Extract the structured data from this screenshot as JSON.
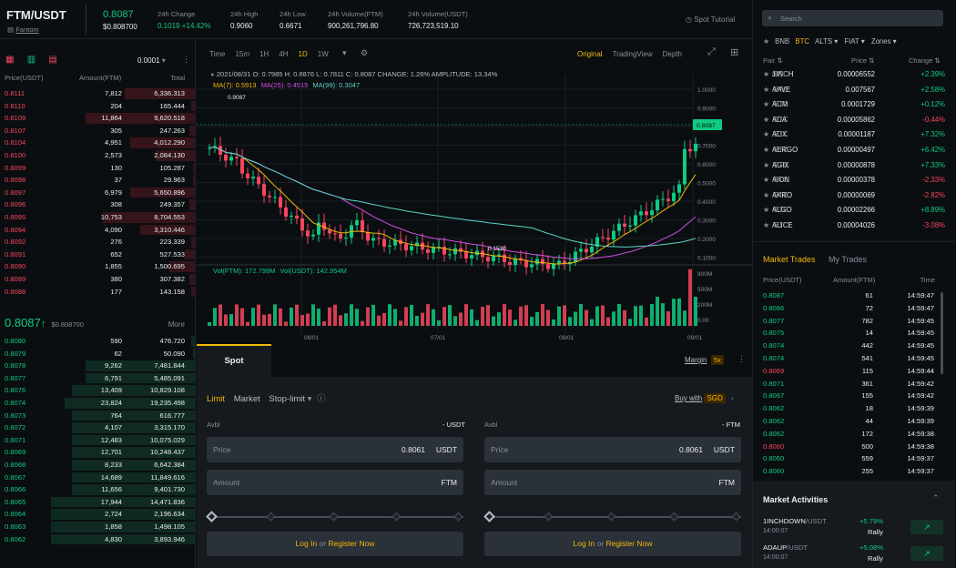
{
  "header": {
    "pair": "FTM/USDT",
    "project": "Fantom",
    "price": "0.8087",
    "price_usd": "$0.808700",
    "stats": [
      {
        "label": "24h Change",
        "value": "0.1019 +14.42%",
        "color": "green"
      },
      {
        "label": "24h High",
        "value": "0.9060"
      },
      {
        "label": "24h Low",
        "value": "0.6671"
      },
      {
        "label": "24h Volume(FTM)",
        "value": "900,261,796.80"
      },
      {
        "label": "24h Volume(USDT)",
        "value": "726,723,519.10"
      }
    ],
    "spot_tutorial": "Spot Tutorial"
  },
  "orderbook": {
    "precision": "0.0001",
    "columns": [
      "Price(USDT)",
      "Amount(FTM)",
      "Total"
    ],
    "asks": [
      [
        "0.8111",
        "7,812",
        "6,336.313"
      ],
      [
        "0.8110",
        "204",
        "165.444"
      ],
      [
        "0.8109",
        "11,864",
        "9,620.518"
      ],
      [
        "0.8107",
        "305",
        "247.263"
      ],
      [
        "0.8104",
        "4,951",
        "4,012.290"
      ],
      [
        "0.8100",
        "2,573",
        "2,084.130"
      ],
      [
        "0.8099",
        "130",
        "105.287"
      ],
      [
        "0.8098",
        "37",
        "29.963"
      ],
      [
        "0.8097",
        "6,979",
        "5,650.896"
      ],
      [
        "0.8096",
        "308",
        "249.357"
      ],
      [
        "0.8095",
        "10,753",
        "8,704.553"
      ],
      [
        "0.8094",
        "4,090",
        "3,310.446"
      ],
      [
        "0.8092",
        "276",
        "223.339"
      ],
      [
        "0.8091",
        "652",
        "527.533"
      ],
      [
        "0.8090",
        "1,855",
        "1,500.695"
      ],
      [
        "0.8089",
        "380",
        "307.382"
      ],
      [
        "0.8088",
        "177",
        "143.158"
      ]
    ],
    "ask_depth": [
      0.36,
      0.02,
      0.56,
      0.03,
      0.33,
      0.2,
      0.01,
      0.01,
      0.33,
      0.03,
      0.47,
      0.28,
      0.02,
      0.05,
      0.13,
      0.03,
      0.02
    ],
    "mid_price": "0.8087",
    "mid_arrow": "↑",
    "mid_usd": "$0.808700",
    "more": "More",
    "bids": [
      [
        "0.8080",
        "590",
        "476.720"
      ],
      [
        "0.8079",
        "62",
        "50.090"
      ],
      [
        "0.8078",
        "9,262",
        "7,481.844"
      ],
      [
        "0.8077",
        "6,791",
        "5,485.091"
      ],
      [
        "0.8076",
        "13,409",
        "10,829.108"
      ],
      [
        "0.8074",
        "23,824",
        "19,235.498"
      ],
      [
        "0.8073",
        "764",
        "616.777"
      ],
      [
        "0.8072",
        "4,107",
        "3,315.170"
      ],
      [
        "0.8071",
        "12,483",
        "10,075.029"
      ],
      [
        "0.8069",
        "12,701",
        "10,248.437"
      ],
      [
        "0.8068",
        "8,233",
        "6,642.384"
      ],
      [
        "0.8067",
        "14,689",
        "11,849.616"
      ],
      [
        "0.8066",
        "11,656",
        "9,401.730"
      ],
      [
        "0.8065",
        "17,944",
        "14,471.836"
      ],
      [
        "0.8064",
        "2,724",
        "2,196.634"
      ],
      [
        "0.8063",
        "1,858",
        "1,498.105"
      ],
      [
        "0.8062",
        "4,830",
        "3,893.946"
      ]
    ],
    "bid_depth": [
      0.02,
      0.01,
      0.56,
      0.56,
      0.63,
      0.67,
      0.63,
      0.63,
      0.63,
      0.63,
      0.63,
      0.63,
      0.63,
      0.74,
      0.74,
      0.74,
      0.74
    ]
  },
  "chart": {
    "intervals": [
      "Time",
      "15m",
      "1H",
      "4H",
      "1D",
      "1W"
    ],
    "active_interval": "1D",
    "views": [
      "Original",
      "TradingView",
      "Depth"
    ],
    "active_view": "Original",
    "ohlc": "2021/08/31  O: 0.7985  H: 0.8876  L: 0.7811  C: 0.8087  CHANGE: 1.26%  AMPLITUDE: 13.34%",
    "ma7": "MA(7): 0.5913",
    "ma25": "MA(25): 0.4515",
    "ma99": "MA(99): 0.3047",
    "vol_ftm": "Vol(FTM): 172.798M",
    "vol_usdt": "Vol(USDT): 142.954M",
    "high_label": "0.9087",
    "low_label": "0.1530",
    "last_price_tag": "0.8087",
    "price_axis": [
      "1.0000",
      "0.9000",
      "0.8000",
      "0.7000",
      "0.6000",
      "0.5000",
      "0.4000",
      "0.3000",
      "0.2000",
      "0.1000"
    ],
    "vol_axis": [
      "800M",
      "500M",
      "200M",
      "0.00"
    ],
    "date_axis": [
      "08/01",
      "07/01",
      "08/01",
      "09/01"
    ]
  },
  "trade": {
    "tab": "Spot",
    "margin": "Margin",
    "leverage": "5x",
    "order_types": [
      "Limit",
      "Market",
      "Stop-limit"
    ],
    "buy_with": "Buy with",
    "buy_currency": "SGD",
    "avbl": "Avbl",
    "buy": {
      "avbl_unit": "- USDT",
      "price_label": "Price",
      "price_value": "0.8061",
      "price_unit": "USDT",
      "amount_label": "Amount",
      "amount_unit": "FTM"
    },
    "sell": {
      "avbl_unit": "- FTM",
      "price_label": "Price",
      "price_value": "0.8061",
      "price_unit": "USDT",
      "amount_label": "Amount",
      "amount_unit": "FTM"
    },
    "login": "Log In",
    "or": "or",
    "register": "Register Now"
  },
  "market": {
    "search_placeholder": "Search",
    "filters": [
      "BNB",
      "BTC",
      "ALTS",
      "FIAT",
      "Zones"
    ],
    "active_filter": "BTC",
    "columns": [
      "Pair",
      "Price",
      "Change"
    ],
    "pairs": [
      [
        "1INCH",
        "/BTC",
        "0.00006552",
        "+2.39%"
      ],
      [
        "AAVE",
        "/BTC",
        "0.007567",
        "+2.58%"
      ],
      [
        "ACM",
        "/BTC",
        "0.0001729",
        "+0.12%"
      ],
      [
        "ADA",
        "/BTC",
        "0.00005862",
        "-0.44%"
      ],
      [
        "ADX",
        "/BTC",
        "0.00001187",
        "+7.32%"
      ],
      [
        "AERGO",
        "/BTC",
        "0.00000497",
        "+6.42%"
      ],
      [
        "AGIX",
        "/BTC",
        "0.00000878",
        "+7.33%"
      ],
      [
        "AION",
        "/BTC",
        "0.00000378",
        "-2.33%"
      ],
      [
        "AKRO",
        "/BTC",
        "0.00000069",
        "-2.82%"
      ],
      [
        "ALGO",
        "/BTC",
        "0.00002266",
        "+8.89%"
      ],
      [
        "ALICE",
        "/BTC",
        "0.00004026",
        "-3.08%"
      ]
    ]
  },
  "trades": {
    "tabs": [
      "Market Trades",
      "My Trades"
    ],
    "columns": [
      "Price(USDT)",
      "Amount(FTM)",
      "Time"
    ],
    "rows": [
      [
        "0.8087",
        "61",
        "14:59:47",
        "g"
      ],
      [
        "0.8086",
        "72",
        "14:59:47",
        "g"
      ],
      [
        "0.8077",
        "782",
        "14:59:45",
        "g"
      ],
      [
        "0.8075",
        "14",
        "14:59:45",
        "g"
      ],
      [
        "0.8074",
        "442",
        "14:59:45",
        "g"
      ],
      [
        "0.8074",
        "541",
        "14:59:45",
        "g"
      ],
      [
        "0.8069",
        "115",
        "14:59:44",
        "r"
      ],
      [
        "0.8071",
        "361",
        "14:59:42",
        "g"
      ],
      [
        "0.8067",
        "155",
        "14:59:42",
        "g"
      ],
      [
        "0.8062",
        "18",
        "14:59:39",
        "g"
      ],
      [
        "0.8062",
        "44",
        "14:59:39",
        "g"
      ],
      [
        "0.8062",
        "172",
        "14:59:38",
        "g"
      ],
      [
        "0.8060",
        "500",
        "14:59:38",
        "r"
      ],
      [
        "0.8060",
        "559",
        "14:59:37",
        "g"
      ],
      [
        "0.8060",
        "255",
        "14:59:37",
        "g"
      ]
    ]
  },
  "activities": {
    "title": "Market Activities",
    "items": [
      {
        "pair": "1INCHDOWN",
        "quote": "/USDT",
        "time": "14:00:07",
        "change": "+5.79%",
        "label": "Rally"
      },
      {
        "pair": "ADAUP",
        "quote": "/USDT",
        "time": "14:00:07",
        "change": "+5.08%",
        "label": "Rally"
      }
    ]
  }
}
